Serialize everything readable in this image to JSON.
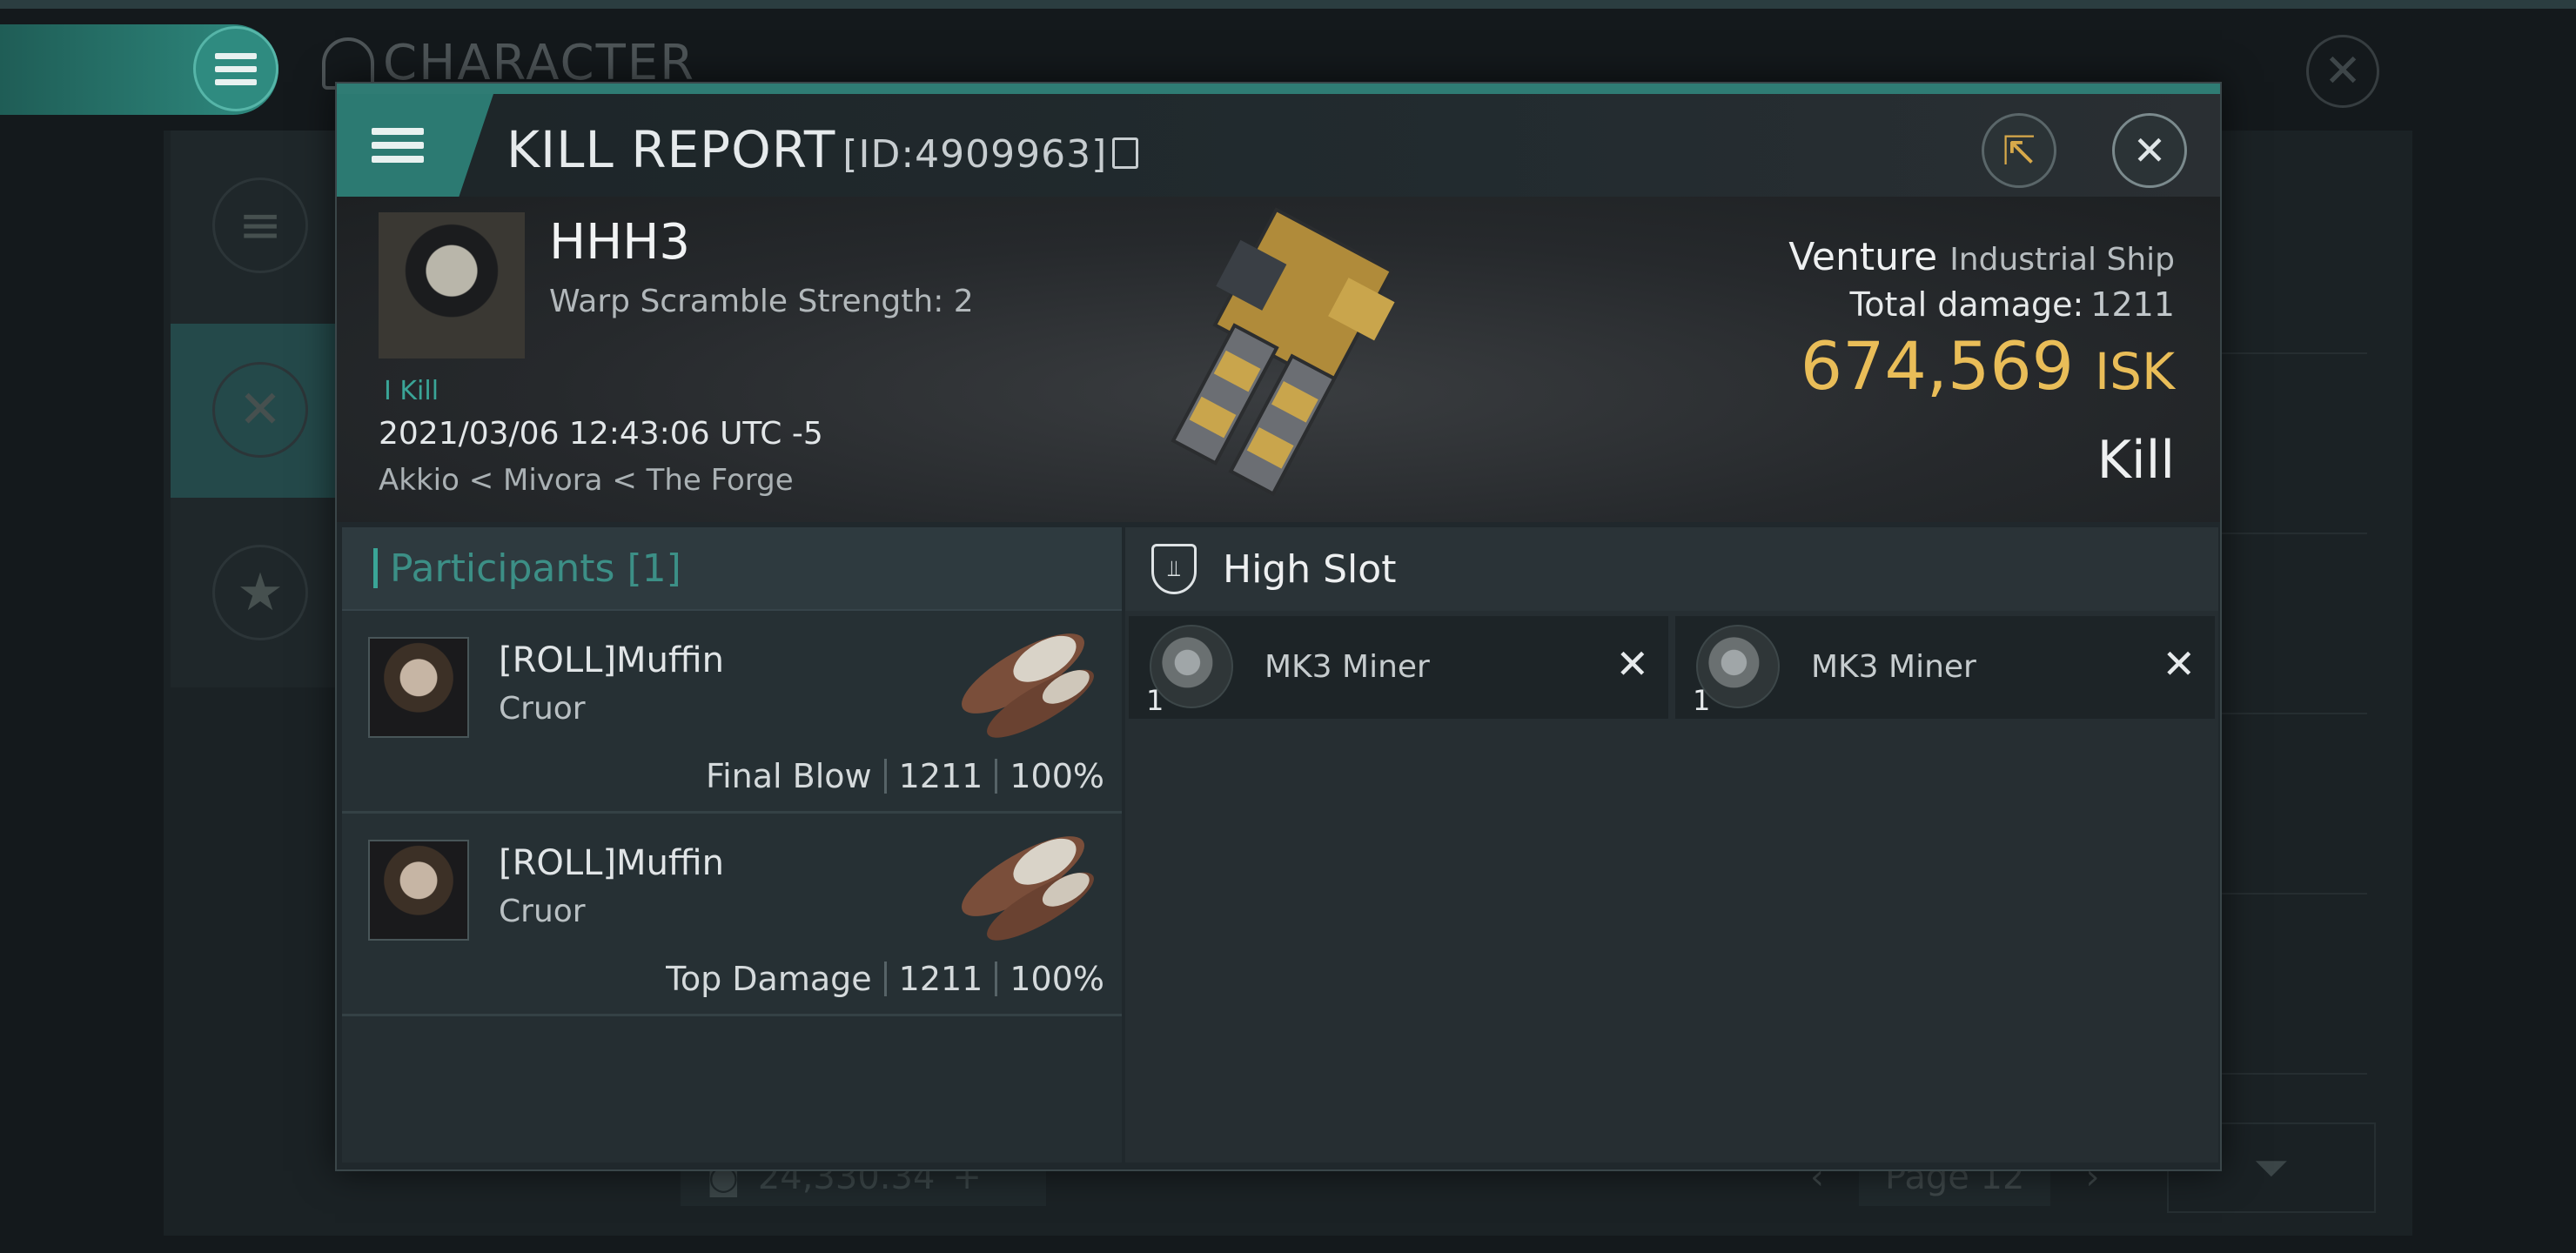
{
  "background": {
    "title": "CHARACTER",
    "balance": "24,330.34",
    "page": "Page 12"
  },
  "header": {
    "title": "KILL REPORT",
    "id": "[ID:4909963]"
  },
  "victim": {
    "name": "HHH3",
    "warp_scramble": "Warp Scramble Strength: 2",
    "kill_tag": "I Kill",
    "time": "2021/03/06 12:43:06 UTC -5",
    "location": "Akkio < Mivora < The Forge",
    "ship_name": "Venture",
    "ship_class": "Industrial Ship",
    "total_damage_label": "Total damage:",
    "total_damage": "1211",
    "isk_value": "674,569",
    "isk_unit": "ISK",
    "result": "Kill"
  },
  "participants": {
    "header": "Participants [1]",
    "items": [
      {
        "name": "[ROLL]Muffin",
        "ship": "Cruor",
        "role": "Final Blow",
        "damage": "1211",
        "percent": "100%"
      },
      {
        "name": "[ROLL]Muffin",
        "ship": "Cruor",
        "role": "Top Damage",
        "damage": "1211",
        "percent": "100%"
      }
    ]
  },
  "slots": {
    "header": "High Slot",
    "items": [
      {
        "name": "MK3 Miner",
        "qty": "1"
      },
      {
        "name": "MK3 Miner",
        "qty": "1"
      }
    ]
  },
  "colors": {
    "accent": "#2f7c74",
    "isk": "#e9bd58",
    "teal_text": "#3aa597"
  }
}
